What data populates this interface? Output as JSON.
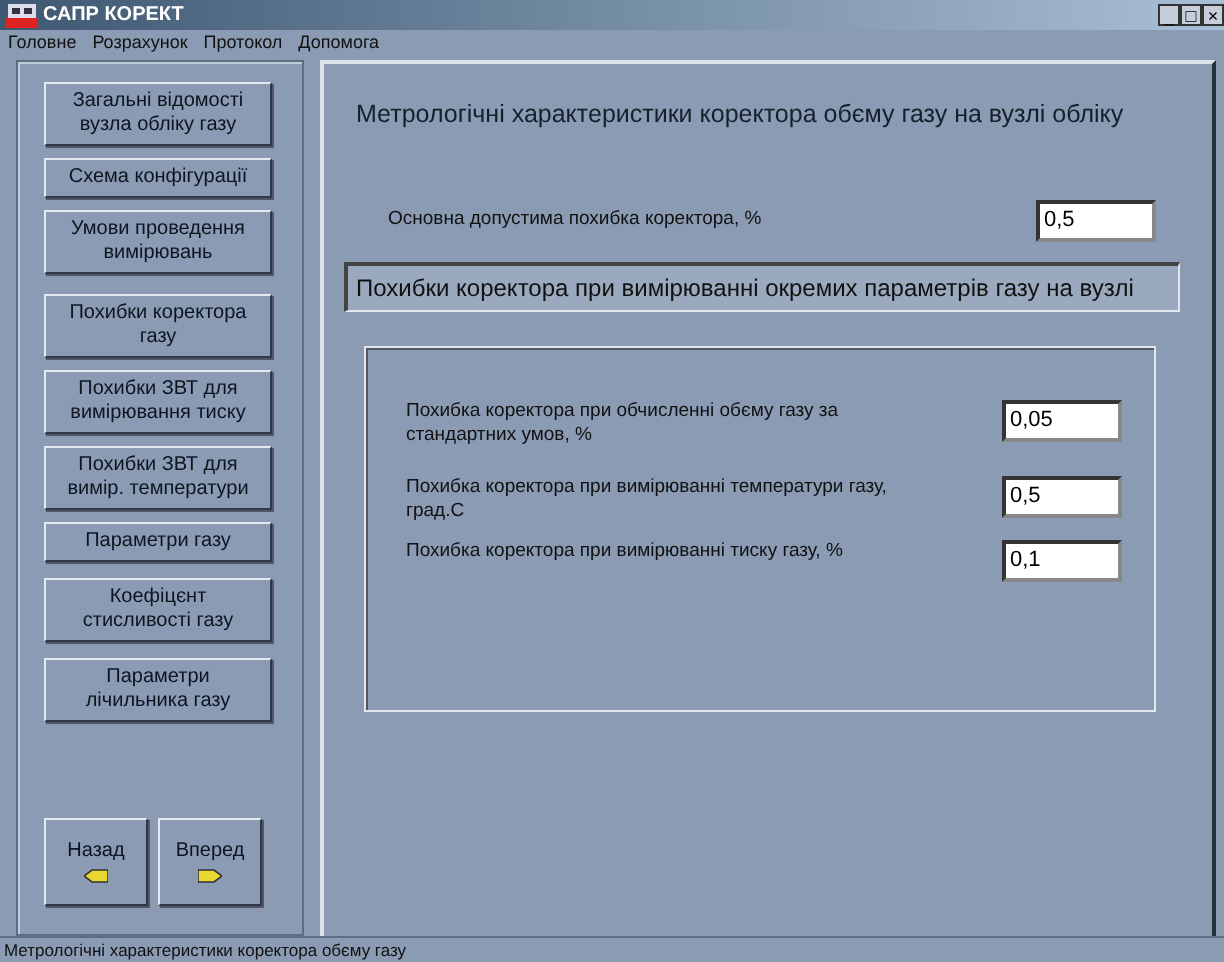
{
  "window": {
    "title": "САПР КОРЕКТ",
    "controls": [
      "_",
      "□",
      "×"
    ]
  },
  "menu": [
    "Головне",
    "Розрахунок",
    "Протокол",
    "Допомога"
  ],
  "sidebar": {
    "buttons": [
      {
        "label": "Загальні відомості вузла обліку газу"
      },
      {
        "label": "Схема конфігурації"
      },
      {
        "label": "Умови проведення вимірювань"
      },
      {
        "label": "Похибки коректора газу"
      },
      {
        "label": "Похибки ЗВТ для вимірювання тиску"
      },
      {
        "label": "Похибки ЗВТ для вимір. температури"
      },
      {
        "label": "Параметри газу"
      },
      {
        "label": "Коефіцєнт стисливості газу"
      },
      {
        "label": "Параметри лічильника газу"
      }
    ],
    "nav": [
      {
        "label": "Назад",
        "kind": "back"
      },
      {
        "label": "Вперед",
        "kind": "forward"
      }
    ]
  },
  "main": {
    "heading": "Метрологічні характеристики коректора обєму газу на вузлі обліку",
    "base_error": {
      "label": "Основна допустима похибка коректора, %",
      "value": "0,5"
    },
    "section_title": "Похибки коректора при вимірюванні окремих параметрів газу на вузлі",
    "fields": [
      {
        "label": "Похибка коректора при обчисленні обєму газу за стандартних умов, %",
        "value": "0,05"
      },
      {
        "label": "Похибка коректора при вимірюванні температури газу, град.С",
        "value": "0,5"
      },
      {
        "label": "Похибка коректора при вимірюванні тиску газу, %",
        "value": "0,1"
      }
    ]
  },
  "status_bar": "Метрологічні характеристики коректора обєму газу"
}
